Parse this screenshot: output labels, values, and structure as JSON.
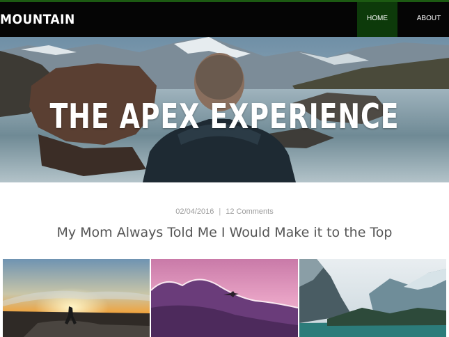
{
  "nav": {
    "brand": "MOUNTAIN",
    "items": [
      {
        "label": "HOME",
        "active": true
      },
      {
        "label": "ABOUT",
        "active": false
      }
    ]
  },
  "hero": {
    "title": "THE APEX EXPERIENCE"
  },
  "post": {
    "date": "02/04/2016",
    "separator": "|",
    "comments": "12 Comments",
    "title": "My Mom Always Told Me I Would Make it to the Top"
  },
  "colors": {
    "accent_green": "#1c5a12",
    "active_nav_bg": "#0d3a0a",
    "navbar_bg": "#050505"
  }
}
